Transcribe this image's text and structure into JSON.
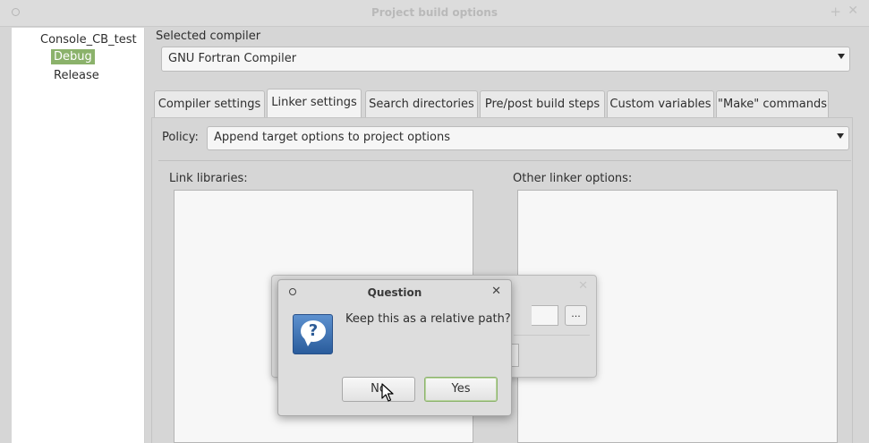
{
  "window": {
    "title": "Project build options",
    "close_icon": "close-icon",
    "maximize_icon": "plus-icon"
  },
  "tree": {
    "root": "Console_CB_test",
    "items": [
      "Debug",
      "Release"
    ],
    "selected": "Debug",
    "selected_color": "#8bb26b"
  },
  "compiler": {
    "label": "Selected compiler",
    "value": "GNU Fortran Compiler"
  },
  "tabs": [
    {
      "label": "Compiler settings"
    },
    {
      "label": "Linker settings"
    },
    {
      "label": "Search directories"
    },
    {
      "label": "Pre/post build steps"
    },
    {
      "label": "Custom variables"
    },
    {
      "label": "\"Make\" commands"
    }
  ],
  "active_tab": "Linker settings",
  "policy": {
    "label": "Policy:",
    "value": "Append target options to project options"
  },
  "linker": {
    "link_libraries_label": "Link libraries:",
    "other_options_label": "Other linker options:"
  },
  "background_dialog": {
    "browse_label": "..."
  },
  "question_dialog": {
    "title": "Question",
    "message": "Keep this as a relative path?",
    "no_label": "No",
    "yes_label": "Yes",
    "icon": "question-icon"
  }
}
